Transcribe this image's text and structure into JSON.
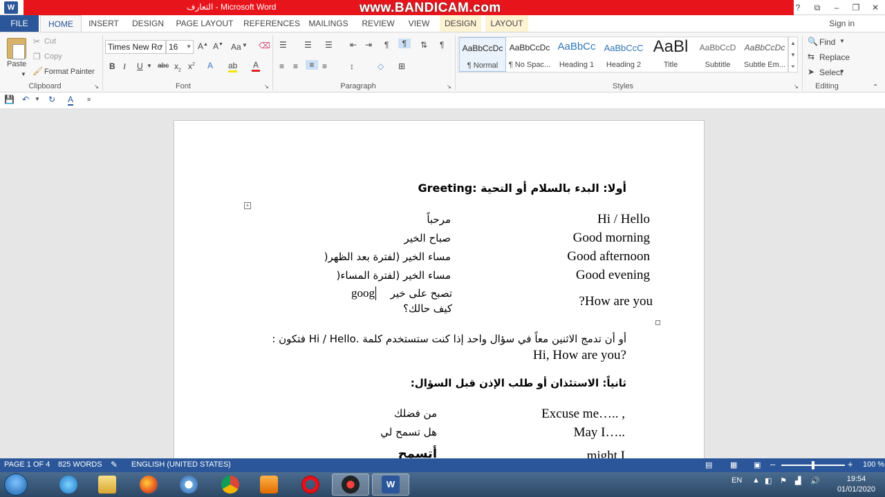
{
  "window": {
    "title": "التعارف  -  Microsoft Word",
    "watermark": "www.BANDICAM.com",
    "controls": [
      "?",
      "⧉",
      "–",
      "❐",
      "✕"
    ]
  },
  "tabs": {
    "file": "FILE",
    "home": "HOME",
    "insert": "INSERT",
    "design": "DESIGN",
    "page_layout": "PAGE LAYOUT",
    "references": "REFERENCES",
    "mailings": "MAILINGS",
    "review": "REVIEW",
    "view": "VIEW",
    "ctx_design": "DESIGN",
    "ctx_layout": "LAYOUT",
    "sign_in": "Sign in"
  },
  "clipboard": {
    "paste": "Paste",
    "cut": "Cut",
    "copy": "Copy",
    "format_painter": "Format Painter",
    "label": "Clipboard"
  },
  "font": {
    "family": "Times New Ro",
    "size": "16",
    "label": "Font",
    "aa": "Aa"
  },
  "paragraph": {
    "label": "Paragraph"
  },
  "styles": {
    "label": "Styles",
    "items": [
      {
        "preview": "AaBbCcDc",
        "name": "¶ Normal"
      },
      {
        "preview": "AaBbCcDc",
        "name": "¶ No Spac..."
      },
      {
        "preview": "AaBbCc",
        "name": "Heading 1"
      },
      {
        "preview": "AaBbCcC",
        "name": "Heading 2"
      },
      {
        "preview": "AaBl",
        "name": "Title"
      },
      {
        "preview": "AaBbCcD",
        "name": "Subtitle"
      },
      {
        "preview": "AaBbCcDc",
        "name": "Subtle Em..."
      }
    ]
  },
  "editing": {
    "find": "Find",
    "replace": "Replace",
    "select": "Select",
    "label": "Editing"
  },
  "document": {
    "heading1": "أولا: البدء بالسلام أو التحية :Greeting",
    "rows": [
      {
        "en": "Hi / Hello",
        "ar": "مرحباً"
      },
      {
        "en": "Good morning",
        "ar": "صباح الخير"
      },
      {
        "en": "Good afternoon",
        "ar": "مساء الخير  (لفترة بعد الظهر("
      },
      {
        "en": "Good evening",
        "ar": "مساء الخير  (لفترة المساء("
      },
      {
        "en": "?How are you",
        "ar": "تصبح على خير",
        "ar_extra": "goog",
        "ar2": "كيف حالك؟"
      }
    ],
    "para_ar": "أو أن تدمج الاثنين معاً في سؤال واحد إذا كنت ستستخدم كلمة .Hi / Hello فتكون :",
    "para_en": "Hi, How are you?",
    "heading2": "ثانياً: الاستئذان أو طلب الإذن قبل السؤال:",
    "rows2": [
      {
        "en": "Excuse me….. ,",
        "ar": "من فضلك"
      },
      {
        "en": "May I…..",
        "ar": "هل تسمح لي"
      },
      {
        "en": "might I",
        "ar": "أتسمح"
      }
    ]
  },
  "status": {
    "page": "PAGE 1 OF 4",
    "words": "825 WORDS",
    "language": "ENGLISH (UNITED STATES)",
    "zoom": "100 %",
    "zoom_level": 1.0
  },
  "taskbar": {
    "lang": "EN",
    "time": "19:54",
    "date": "01/01/2020",
    "apps": [
      "internet-explorer",
      "file-explorer",
      "firefox",
      "opera-browser",
      "chrome",
      "media-player",
      "opera",
      "bandicam",
      "word"
    ]
  }
}
